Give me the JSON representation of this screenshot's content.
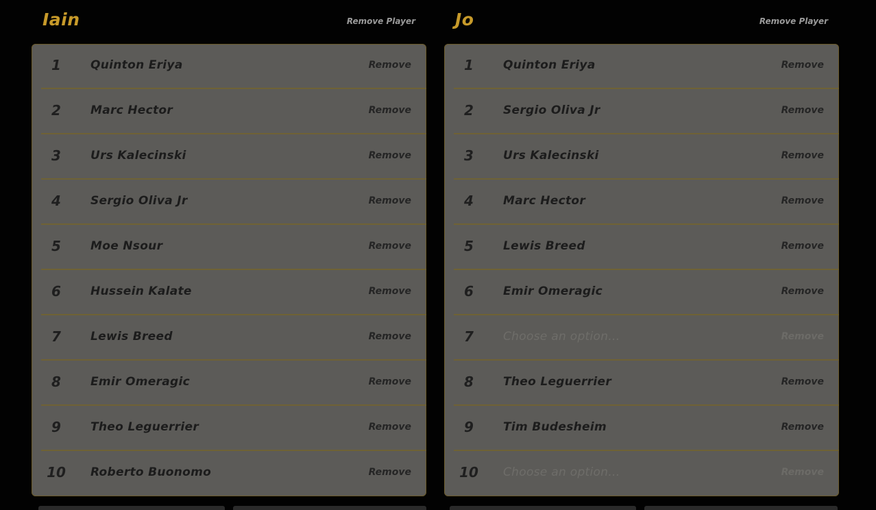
{
  "columns": [
    {
      "player": "Iain",
      "remove_player_label": "Remove Player",
      "rows": [
        {
          "rank": "1",
          "pick": "Quinton Eriya",
          "remove": "Remove",
          "placeholder": false
        },
        {
          "rank": "2",
          "pick": "Marc Hector",
          "remove": "Remove",
          "placeholder": false
        },
        {
          "rank": "3",
          "pick": "Urs Kalecinski",
          "remove": "Remove",
          "placeholder": false
        },
        {
          "rank": "4",
          "pick": "Sergio Oliva Jr",
          "remove": "Remove",
          "placeholder": false
        },
        {
          "rank": "5",
          "pick": "Moe Nsour",
          "remove": "Remove",
          "placeholder": false
        },
        {
          "rank": "6",
          "pick": "Hussein Kalate",
          "remove": "Remove",
          "placeholder": false
        },
        {
          "rank": "7",
          "pick": "Lewis Breed",
          "remove": "Remove",
          "placeholder": false
        },
        {
          "rank": "8",
          "pick": "Emir Omeragic",
          "remove": "Remove",
          "placeholder": false
        },
        {
          "rank": "9",
          "pick": "Theo Leguerrier",
          "remove": "Remove",
          "placeholder": false
        },
        {
          "rank": "10",
          "pick": "Roberto Buonomo",
          "remove": "Remove",
          "placeholder": false
        }
      ]
    },
    {
      "player": "Jo",
      "remove_player_label": "Remove Player",
      "rows": [
        {
          "rank": "1",
          "pick": "Quinton Eriya",
          "remove": "Remove",
          "placeholder": false
        },
        {
          "rank": "2",
          "pick": "Sergio Oliva Jr",
          "remove": "Remove",
          "placeholder": false
        },
        {
          "rank": "3",
          "pick": "Urs Kalecinski",
          "remove": "Remove",
          "placeholder": false
        },
        {
          "rank": "4",
          "pick": "Marc Hector",
          "remove": "Remove",
          "placeholder": false
        },
        {
          "rank": "5",
          "pick": "Lewis Breed",
          "remove": "Remove",
          "placeholder": false
        },
        {
          "rank": "6",
          "pick": "Emir Omeragic",
          "remove": "Remove",
          "placeholder": false
        },
        {
          "rank": "7",
          "pick": "Choose an option...",
          "remove": "Remove",
          "placeholder": true
        },
        {
          "rank": "8",
          "pick": "Theo Leguerrier",
          "remove": "Remove",
          "placeholder": false
        },
        {
          "rank": "9",
          "pick": "Tim Budesheim",
          "remove": "Remove",
          "placeholder": false
        },
        {
          "rank": "10",
          "pick": "Choose an option...",
          "remove": "Remove",
          "placeholder": true
        }
      ]
    }
  ],
  "colors": {
    "accent_gold": "#c79a2a",
    "card_bg": "#5c5b58",
    "row_divider": "#6f6235",
    "page_bg": "#020202"
  }
}
